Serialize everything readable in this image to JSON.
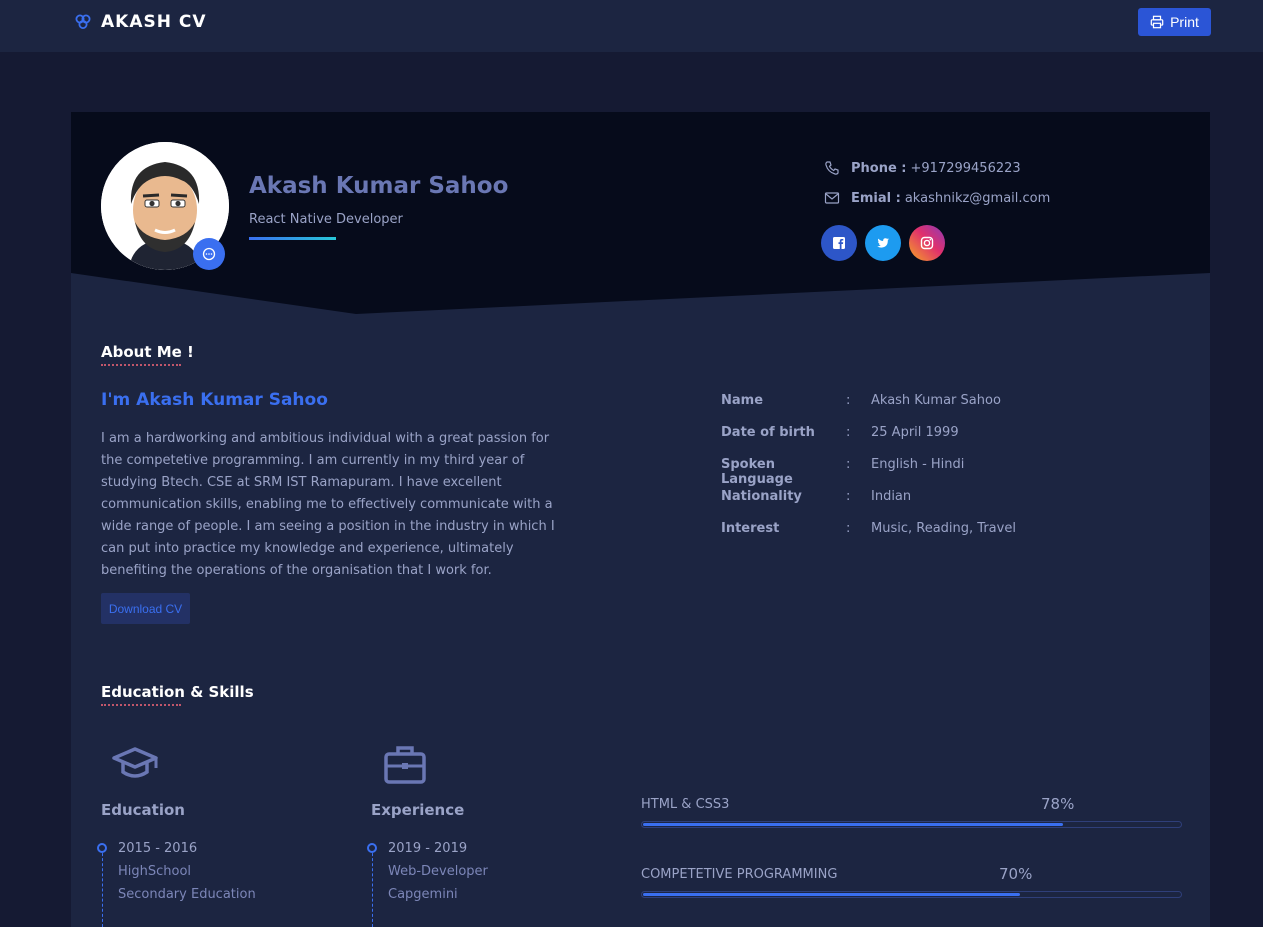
{
  "navbar": {
    "brand": "AKASH CV",
    "print_label": "Print"
  },
  "hero": {
    "name": "Akash Kumar Sahoo",
    "role": "React Native Developer",
    "phone_label": "Phone :",
    "phone": "+917299456223",
    "email_label": "Emial :",
    "email": "akashnikz@gmail.com",
    "social": [
      {
        "icon": "facebook-icon",
        "color": "#2d56c8"
      },
      {
        "icon": "twitter-icon",
        "color": "#1d9bf0"
      },
      {
        "icon": "instagram-icon",
        "color": "#e1306c"
      }
    ]
  },
  "about": {
    "section_title": "About Me !",
    "heading": "I'm Akash Kumar Sahoo",
    "paragraph": "I am a hardworking and ambitious individual with a great passion for the competetive programming. I am currently in my third year of studying Btech. CSE at SRM IST Ramapuram. I have excellent communication skills, enabling me to effectively communicate with a wide range of people. I am seeing a position in the industry in which I can put into practice my knowledge and experience, ultimately benefiting the operations of the organisation that I work for.",
    "download_label": "Download CV",
    "info": [
      {
        "key": "Name",
        "value": "Akash Kumar Sahoo"
      },
      {
        "key": "Date of birth",
        "value": "25 April 1999"
      },
      {
        "key": "Spoken Language",
        "value": "English - Hindi"
      },
      {
        "key": "Nationality",
        "value": "Indian"
      },
      {
        "key": "Interest",
        "value": "Music, Reading, Travel"
      }
    ],
    "colon": ":"
  },
  "skills_section": {
    "section_title": "Education & Skills",
    "education": {
      "title": "Education",
      "period": "2015 - 2016",
      "line1": "HighSchool",
      "line2": "Secondary Education"
    },
    "experience": {
      "title": "Experience",
      "period": "2019 - 2019",
      "line1": "Web-Developer",
      "line2": "Capgemini"
    },
    "skills": [
      {
        "name": "HTML & CSS3",
        "percent_label": "78%",
        "level": 0.78
      },
      {
        "name": "COMPETETIVE PROGRAMMING",
        "percent_label": "70%",
        "level": 0.7
      }
    ]
  },
  "colors": {
    "accent": "#3a6ff0",
    "background": "#151a33",
    "card": "#1c2541",
    "hero": "#060b1b"
  }
}
